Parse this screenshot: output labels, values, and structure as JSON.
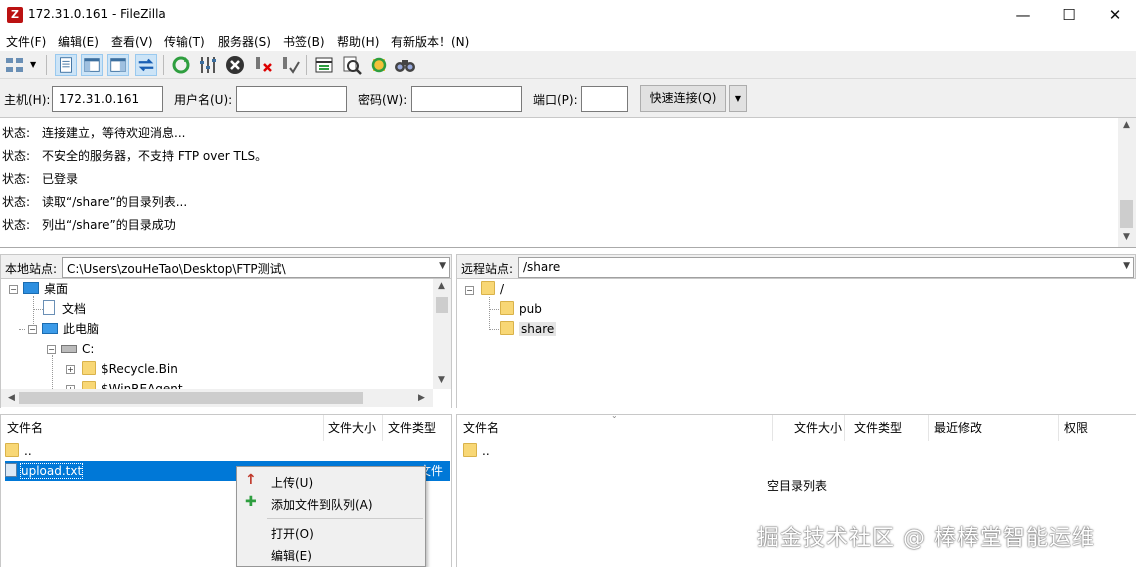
{
  "window": {
    "title": "172.31.0.161 - FileZilla",
    "minimize_glyph": "—",
    "maximize_glyph": "☐",
    "close_glyph": "✕"
  },
  "menu": [
    "文件(F)",
    "编辑(E)",
    "查看(V)",
    "传输(T)",
    "服务器(S)",
    "书签(B)",
    "帮助(H)",
    "有新版本！(N)"
  ],
  "toolbar_icons": [
    "site-manager-icon",
    "toggle-message-log-icon",
    "toggle-local-tree-icon",
    "toggle-remote-tree-icon",
    "toggle-transfer-queue-icon",
    "refresh-icon",
    "process-queue-icon",
    "cancel-icon",
    "disconnect-icon",
    "reconnect-icon",
    "directory-filter-icon",
    "comparison-icon",
    "sync-browsing-icon",
    "search-icon"
  ],
  "quickconnect": {
    "host_label": "主机(H):",
    "host_value": "172.31.0.161",
    "user_label": "用户名(U):",
    "user_value": "",
    "password_label": "密码(W):",
    "password_value": "",
    "port_label": "端口(P):",
    "port_value": "",
    "connect_button": "快速连接(Q)"
  },
  "log": [
    {
      "label": "状态:",
      "text": "连接建立，等待欢迎消息..."
    },
    {
      "label": "状态:",
      "text": "不安全的服务器，不支持 FTP over TLS。"
    },
    {
      "label": "状态:",
      "text": "已登录"
    },
    {
      "label": "状态:",
      "text": "读取“/share”的目录列表..."
    },
    {
      "label": "状态:",
      "text": "列出“/share”的目录成功"
    }
  ],
  "local": {
    "site_label": "本地站点:",
    "path": "C:\\Users\\zouHeTao\\Desktop\\FTP测试\\",
    "tree": [
      "桌面",
      "文档",
      "此电脑",
      "C:",
      "$Recycle.Bin",
      "$WinREAgent"
    ],
    "columns": [
      "文件名",
      "文件大小",
      "文件类型"
    ],
    "files": [
      {
        "name": "..",
        "type": ""
      },
      {
        "name": "upload.txt",
        "type": "文件"
      }
    ]
  },
  "remote": {
    "site_label": "远程站点:",
    "path": "/share",
    "tree": [
      "/",
      "pub",
      "share"
    ],
    "columns": [
      "文件名",
      "文件大小",
      "文件类型",
      "最近修改",
      "权限"
    ],
    "files": [
      {
        "name": ".."
      }
    ],
    "empty_text": "空目录列表"
  },
  "context_menu": [
    {
      "label": "上传(U)",
      "icon": "upload-arrow-icon"
    },
    {
      "label": "添加文件到队列(A)",
      "icon": "add-to-queue-icon"
    },
    {
      "label": "打开(O)",
      "icon": ""
    },
    {
      "label": "编辑(E)",
      "icon": ""
    }
  ],
  "watermark": "掘金技术社区 @ 棒棒堂智能运维",
  "colors": {
    "selection": "#0078d7",
    "folder": "#f8d775",
    "toolbar_bg": "#f0f0f0"
  }
}
